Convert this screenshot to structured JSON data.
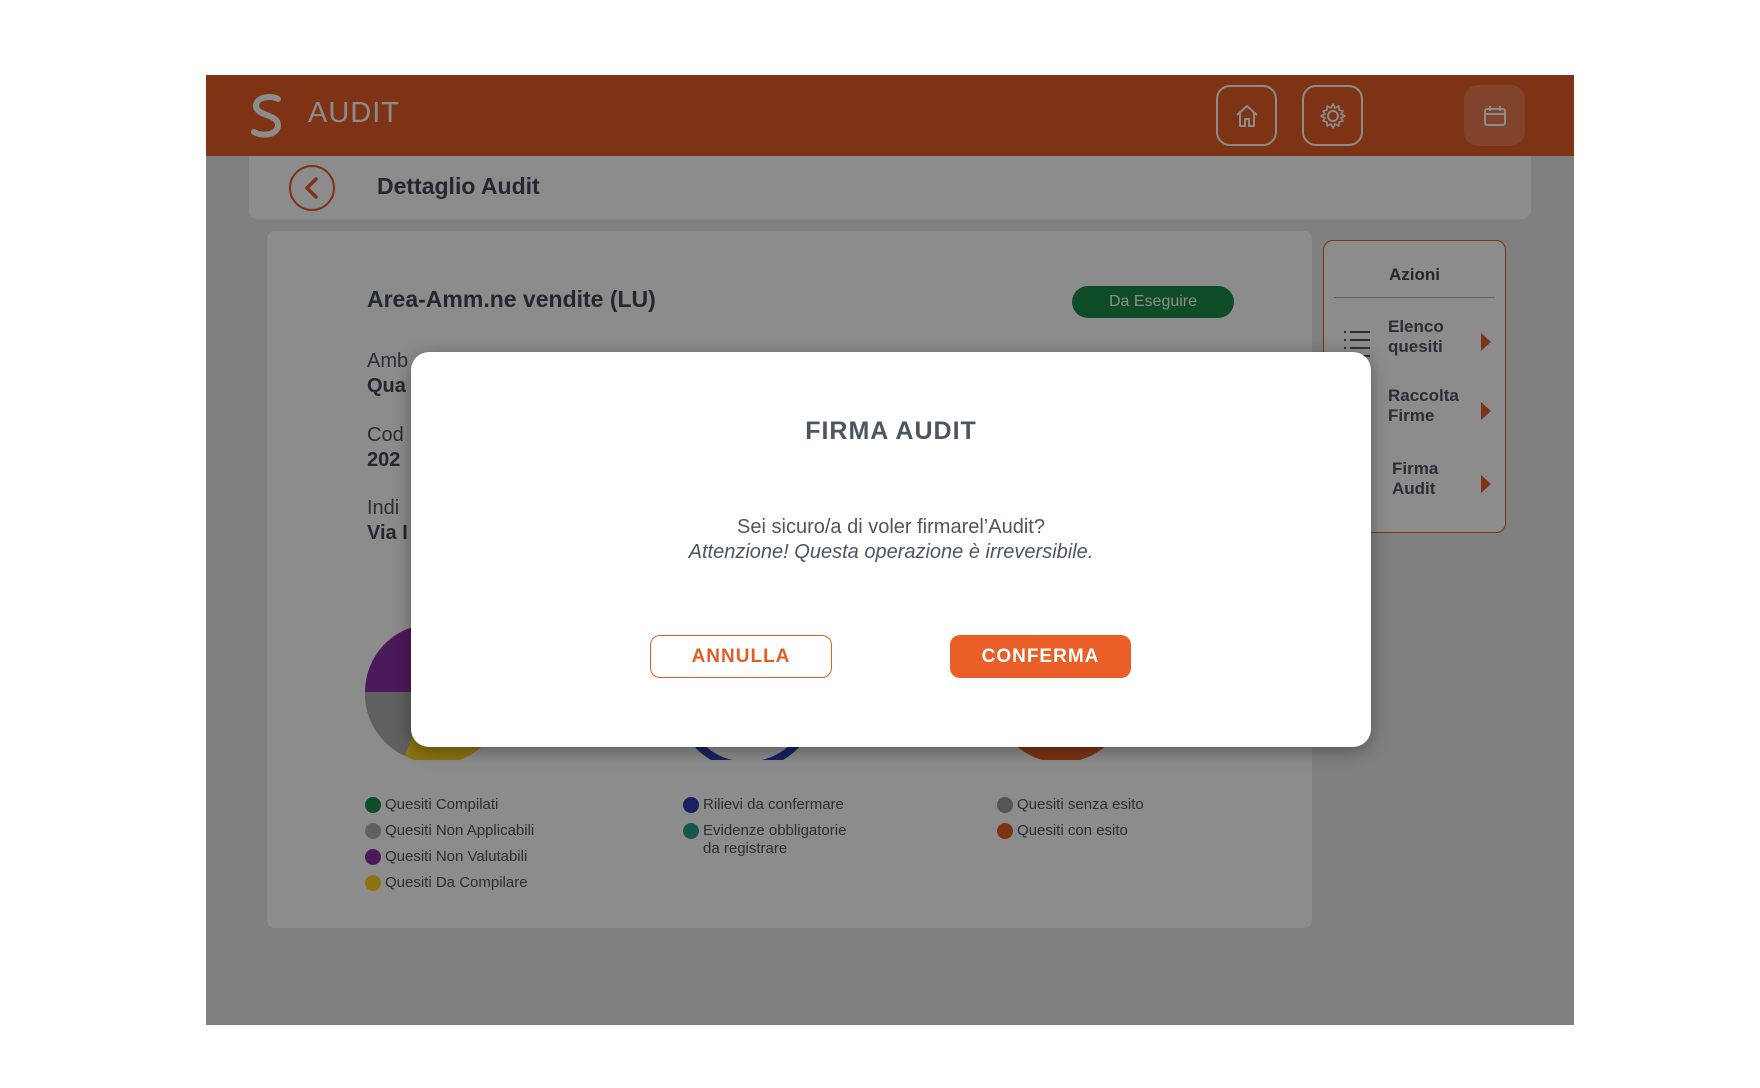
{
  "header": {
    "app_title": "AUDIT",
    "brand_color": "#e35d26",
    "icons": [
      "home-icon",
      "gear-icon",
      "calendar-icon"
    ]
  },
  "subheader": {
    "title": "Dettaglio Audit"
  },
  "card": {
    "area_title": "Area-Amm.ne vendite (LU)",
    "status": "Da Eseguire",
    "status_color": "#1a8a4a",
    "fields": [
      {
        "label": "Amb",
        "value": "Qua"
      },
      {
        "label": "Cod",
        "value": "202"
      },
      {
        "label": "Indi",
        "value": "Via I"
      }
    ],
    "legends": [
      [
        {
          "label": "Quesiti Compilati",
          "color": "#1a8a4a"
        },
        {
          "label": "Quesiti Non Applicabili",
          "color": "#b0b0b0"
        },
        {
          "label": "Quesiti Non Valutabili",
          "color": "#8a2ea6"
        },
        {
          "label": "Quesiti Da Compilare",
          "color": "#ffd21f"
        }
      ],
      [
        {
          "label": "Rilievi da confermare",
          "color": "#2b3fb3"
        },
        {
          "label_line1": "Evidenze obbligatorie",
          "label_line2": "da registrare",
          "color": "#2a9d8f"
        }
      ],
      [
        {
          "label": "Quesiti senza esito",
          "color": "#9b9b9b"
        },
        {
          "label": "Quesiti con esito",
          "color": "#e35d26"
        }
      ]
    ]
  },
  "actions": {
    "title": "Azioni",
    "items": [
      {
        "line1": "Elenco",
        "line2": "quesiti",
        "icon": "list-icon"
      },
      {
        "line1": "Raccolta",
        "line2": "Firme",
        "icon": "pen-icon"
      },
      {
        "line1": "Firma",
        "line2": "Audit",
        "icon": "clock-icon"
      }
    ]
  },
  "modal": {
    "title": "FIRMA AUDIT",
    "question": "Sei sicuro/a di voler firmarel’Audit?",
    "warning": "Attenzione! Questa operazione è irreversibile.",
    "cancel_label": "ANNULLA",
    "confirm_label": "CONFERMA"
  }
}
